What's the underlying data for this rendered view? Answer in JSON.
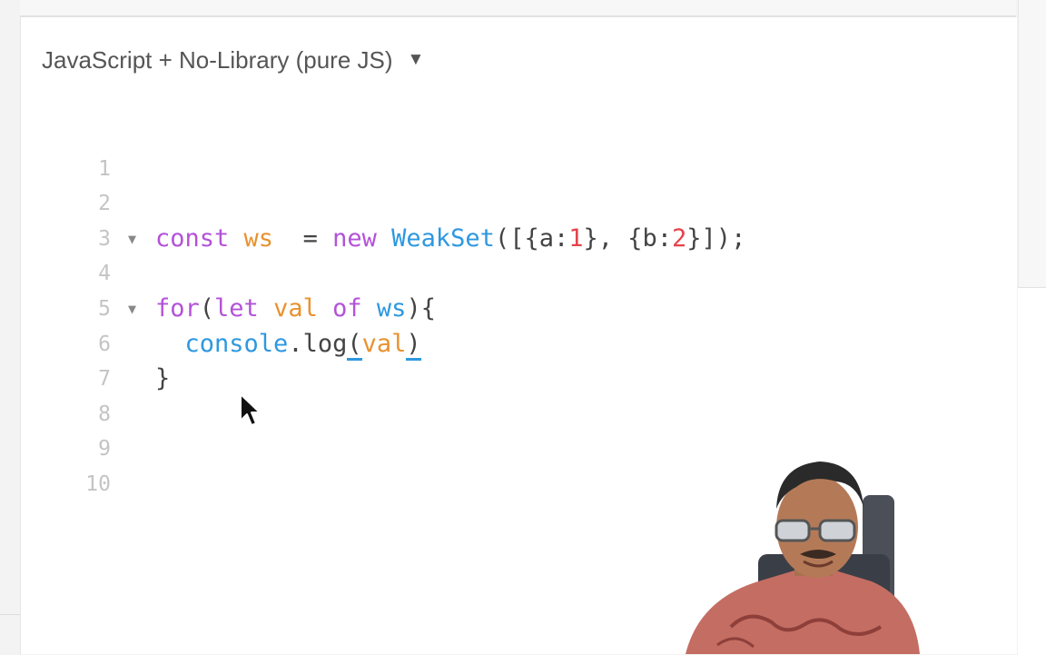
{
  "language_selector": {
    "label": "JavaScript + No-Library (pure JS)",
    "arrow": "▼"
  },
  "editor": {
    "line_numbers": [
      "1",
      "2",
      "3",
      "4",
      "5",
      "6",
      "7",
      "8",
      "9",
      "10"
    ],
    "fold_marker": "▼",
    "line4": {
      "kw_const": "const",
      "var_ws": "ws",
      "assign": "  = ",
      "kw_new": "new",
      "cls": "WeakSet",
      "p1": "([{a:",
      "n1": "1",
      "p2": "}, {b:",
      "n2": "2",
      "p3": "}]);"
    },
    "line6": {
      "kw_for": "for",
      "p1": "(",
      "kw_let": "let",
      "var_val": "val",
      "kw_of": "of",
      "var_ws": "ws",
      "p2": "){"
    },
    "line7": {
      "obj": "console",
      "dot": ".",
      "method": "log",
      "open": "(",
      "arg": "val",
      "close": ")"
    },
    "line8": {
      "brace": "}"
    }
  },
  "icons": {
    "dropdown": "triangle-down",
    "fold": "triangle-down",
    "pointer": "arrow-cursor"
  },
  "colors": {
    "keyword": "#b352d9",
    "variable": "#e8922e",
    "function": "#2e98e0",
    "number": "#e4434b",
    "gutter": "#c4c4c4"
  }
}
